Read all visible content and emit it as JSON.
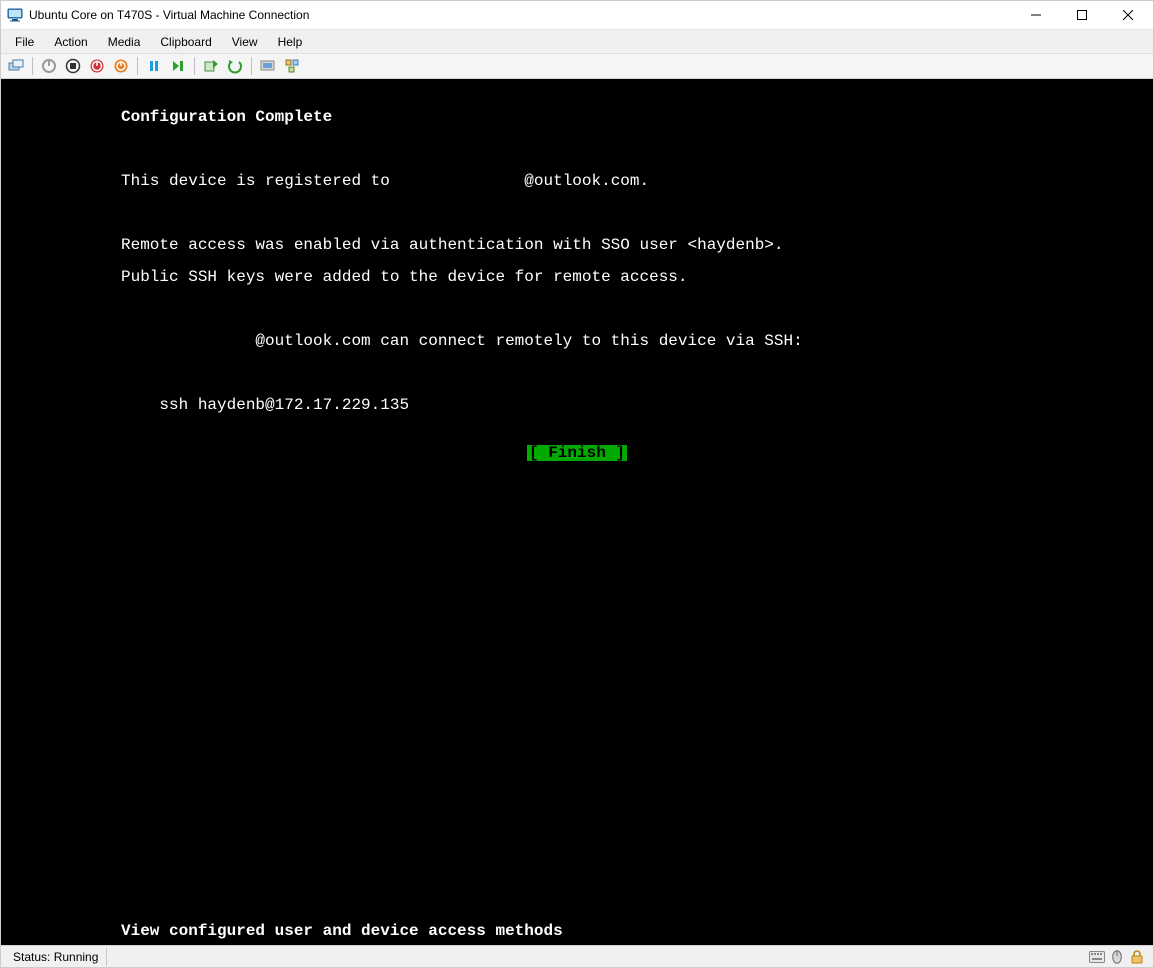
{
  "window": {
    "title": "Ubuntu Core on T470S - Virtual Machine Connection"
  },
  "menu": {
    "items": [
      "File",
      "Action",
      "Media",
      "Clipboard",
      "View",
      "Help"
    ]
  },
  "toolbar_icons": [
    "ctrl-alt-del-icon",
    "start-icon-gray",
    "stop-icon",
    "shutdown-icon",
    "reset-icon",
    "pause-icon",
    "resume-icon",
    "checkpoint-icon",
    "revert-icon",
    "enhanced-session-icon",
    "share-icon"
  ],
  "console": {
    "heading": "Configuration Complete",
    "line1_a": "This device is registered to ",
    "line1_b": "@outlook.com.",
    "line2": "Remote access was enabled via authentication with SSO user <haydenb>.",
    "line3": "Public SSH keys were added to the device for remote access.",
    "line4": "@outlook.com can connect remotely to this device via SSH:",
    "ssh": "    ssh haydenb@172.17.229.135",
    "finish": "[ Finish ]",
    "hint": "View configured user and device access methods"
  },
  "status": {
    "text": "Status: Running"
  }
}
